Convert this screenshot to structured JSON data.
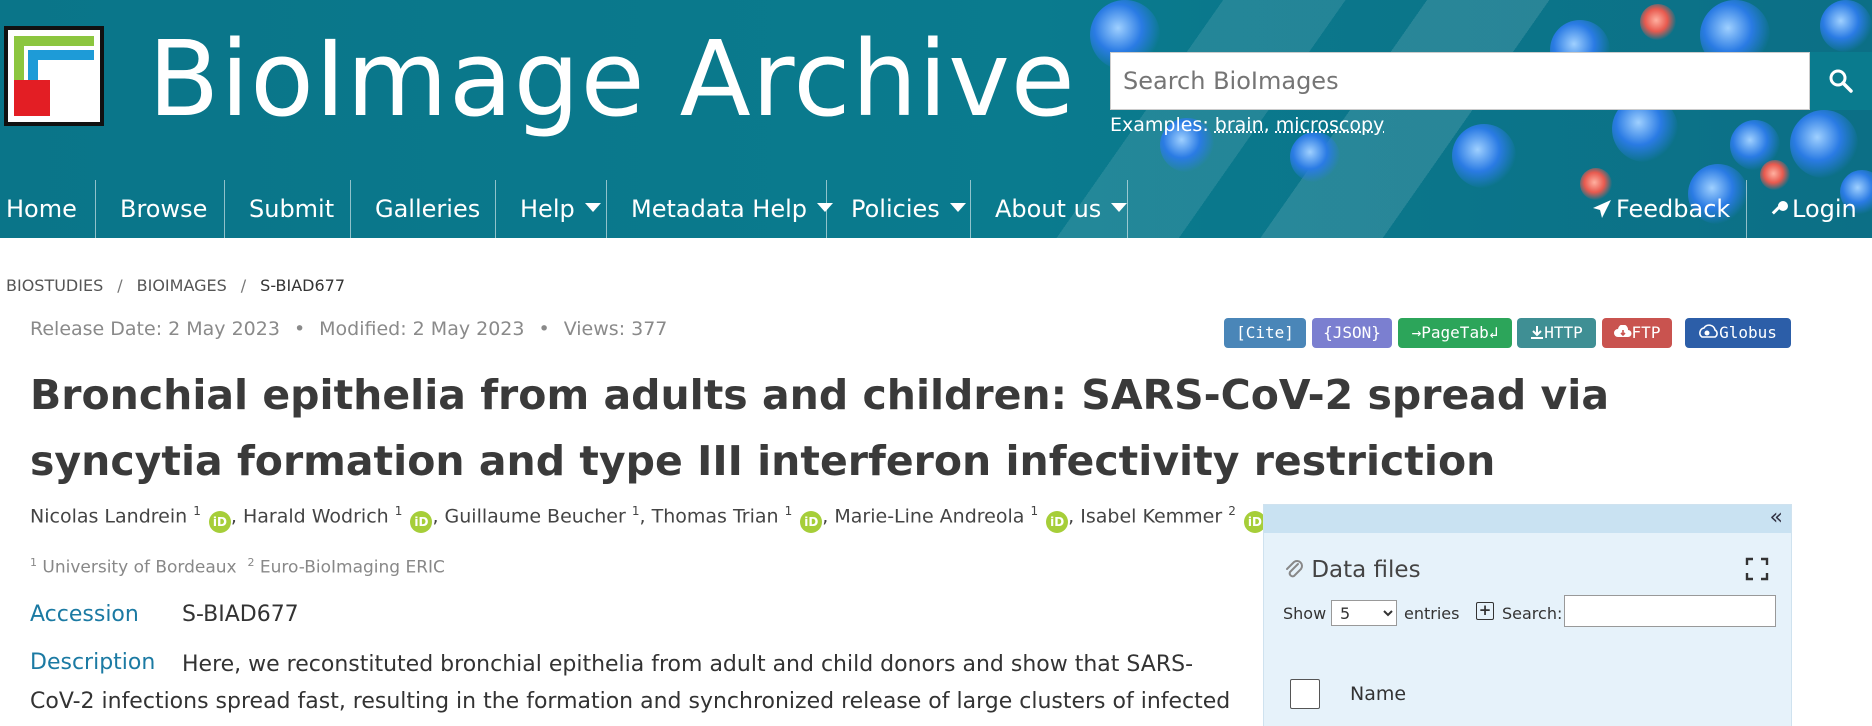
{
  "header": {
    "brand_title": "BioImage Archive",
    "search_placeholder": "Search BioImages",
    "examples_label": "Examples:",
    "examples": [
      "brain",
      "microscopy"
    ],
    "colors": {
      "header_bg": "#0a7b8e",
      "logo_green": "#8cc63f",
      "logo_blue": "#1e9bd7",
      "logo_red": "#e31e24"
    }
  },
  "nav": {
    "items": [
      "Home",
      "Browse",
      "Submit",
      "Galleries",
      "Help",
      "Metadata Help",
      "Policies",
      "About us"
    ],
    "right": [
      "Feedback",
      "Login"
    ]
  },
  "breadcrumb": [
    "BIOSTUDIES",
    "BIOIMAGES",
    "S-BIAD677"
  ],
  "meta": {
    "release": "Release Date: 2 May 2023",
    "modified": "Modified: 2 May 2023",
    "views": "Views: 377"
  },
  "badges": [
    {
      "label": "[Cite]",
      "color": "#4a86b8"
    },
    {
      "label": "{JSON}",
      "color": "#7b7fd0"
    },
    {
      "label": "→PageTab↲",
      "color": "#2ca55a"
    },
    {
      "label": "HTTP",
      "color": "#3f8f94"
    },
    {
      "label": "FTP",
      "color": "#c9534f"
    },
    {
      "label": "Globus",
      "color": "#2c5ea8"
    }
  ],
  "title": "Bronchial epithelia from adults and children: SARS-CoV-2 spread via syncytia formation and type III interferon infectivity restriction",
  "authors": [
    {
      "name": "Nicolas Landrein",
      "aff": "1",
      "orcid": true
    },
    {
      "name": "Harald Wodrich",
      "aff": "1",
      "orcid": true
    },
    {
      "name": "Guillaume Beucher",
      "aff": "1",
      "orcid": false
    },
    {
      "name": "Thomas Trian",
      "aff": "1",
      "orcid": true
    },
    {
      "name": "Marie-Line Andreola",
      "aff": "1",
      "orcid": true
    },
    {
      "name": "Isabel Kemmer",
      "aff": "2",
      "orcid": true
    }
  ],
  "affiliations": [
    {
      "num": "1",
      "name": "University of Bordeaux"
    },
    {
      "num": "2",
      "name": "Euro-BioImaging ERIC"
    }
  ],
  "fields": {
    "accession_label": "Accession",
    "accession_value": "S-BIAD677",
    "description_label": "Description",
    "description_text": "Here, we reconstituted bronchial epithelia from adult and child donors and show that SARS-CoV-2 infections spread fast, resulting in the formation and synchronized release of large clusters of infected cells and"
  },
  "data_files": {
    "title": "Data files",
    "show_label": "Show",
    "entries_value": "5",
    "entries_label": "entries",
    "search_label": "Search:",
    "column_name": "Name"
  }
}
